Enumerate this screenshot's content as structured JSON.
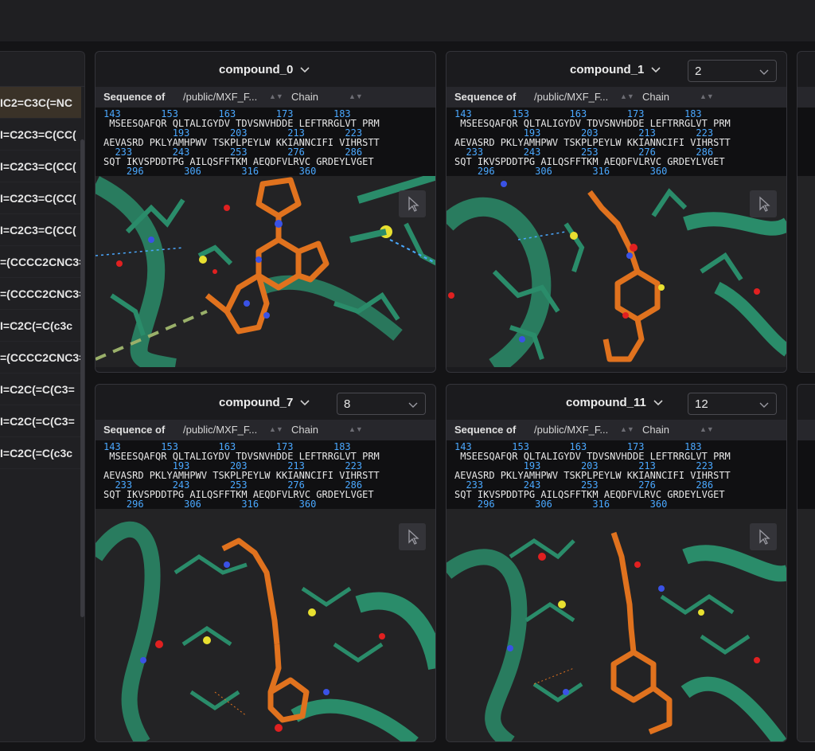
{
  "smiles_list": {
    "rows": [
      "IC2=C3C(=NC",
      "I=C2C3=C(CC(",
      "I=C2C3=C(CC(",
      "I=C2C3=C(CC(",
      "I=C2C3=C(CC(",
      "=(CCCC2CNC3=",
      "=(CCCC2CNC3=",
      "I=C2C(=C(c3c",
      "=(CCCC2CNC3=",
      "I=C2C(=C(C3=",
      "I=C2C(=C(C3=",
      "I=C2C(=C(c3c"
    ],
    "selected_index": 0
  },
  "sequence_toolbar": {
    "label": "Sequence of",
    "path": "/public/MXF_F...",
    "chain": "Chain"
  },
  "sequence": {
    "nums1": "143       153       163       173       183",
    "res1": " MSEESQAFQR QLTALIGYDV TDVSNVHDDE LEFTRRGLVT PRM",
    "nums2": "            193       203       213       223",
    "res2": "AEVASRD PKLYAMHPWV TSKPLPEYLW KKIANNCIFI VIHRSTT",
    "nums3": "  233       243       253       276       286",
    "res3": "SQT IKVSPDDTPG AILQSFFTKM AEQDFVLRVC GRDEYLVGET",
    "nums4": "    296       306       316       360"
  },
  "cards": [
    {
      "title": "compound_0",
      "selector": ""
    },
    {
      "title": "compound_1",
      "selector": "2"
    },
    {
      "title": "compound_7",
      "selector": "8"
    },
    {
      "title": "compound_11",
      "selector": "12"
    }
  ],
  "colors": {
    "ligand": "#e0721e",
    "protein": "#2a8c6a",
    "nitrogen": "#3a52e6",
    "oxygen": "#e02020",
    "sulfur": "#e8e030",
    "seq_number": "#4aa8ff"
  },
  "icons": [
    "chevron-down-icon",
    "cursor-pointer-icon",
    "sort-icon"
  ]
}
